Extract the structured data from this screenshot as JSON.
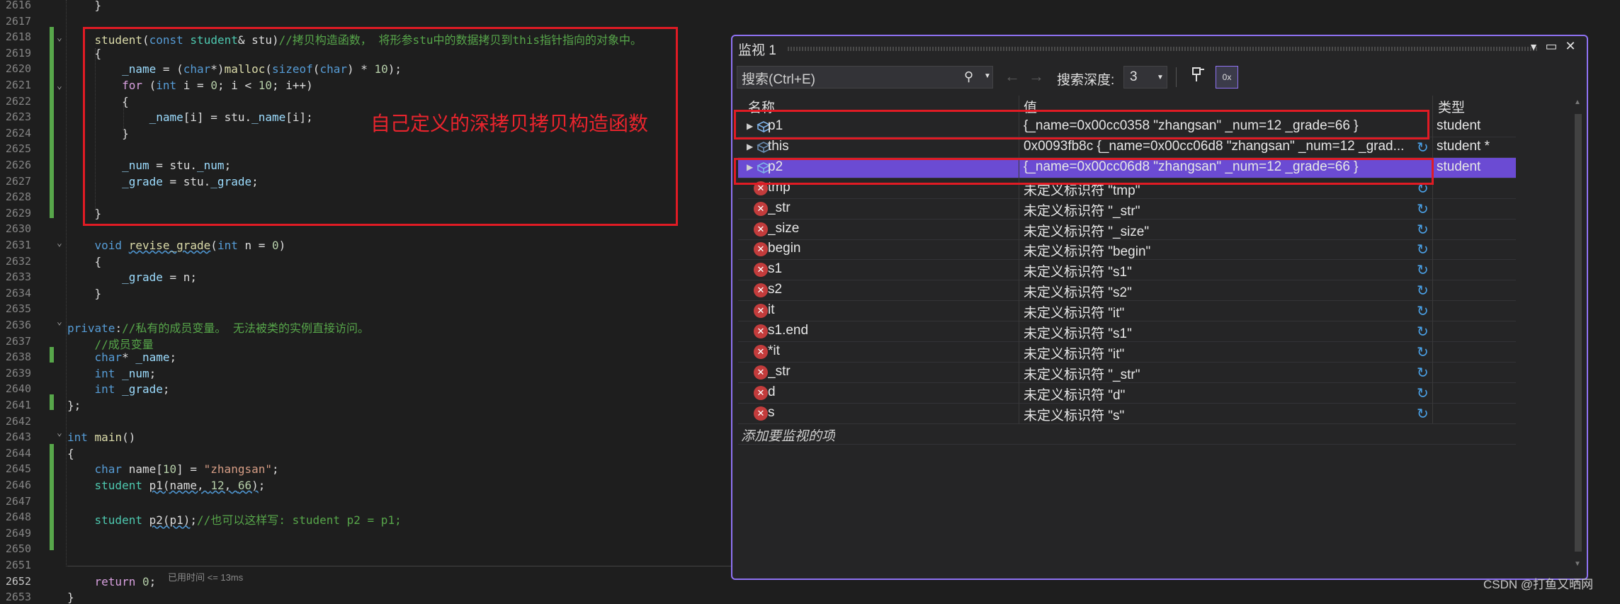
{
  "editor": {
    "lines": [
      {
        "num": "2616",
        "html": "    }"
      },
      {
        "num": "2617",
        "html": ""
      },
      {
        "num": "2618",
        "html": "    <span class='fn'>student</span>(<span class='kw'>const</span> <span class='ty'>student</span>&amp; stu)<span class='cm'>//拷贝构造函数， 将形参stu中的数据拷贝到this指针指向的对象中。</span>"
      },
      {
        "num": "2619",
        "html": "    {"
      },
      {
        "num": "2620",
        "html": "        <span class='fld'>_name</span> = (<span class='kw'>char</span>*)<span class='fn'>malloc</span>(<span class='kw'>sizeof</span>(<span class='kw'>char</span>) * <span class='num'>10</span>);"
      },
      {
        "num": "2621",
        "html": "        <span class='ctrl'>for</span> (<span class='kw'>int</span> i = <span class='num'>0</span>; i &lt; <span class='num'>10</span>; i++)"
      },
      {
        "num": "2622",
        "html": "        {"
      },
      {
        "num": "2623",
        "html": "            <span class='fld'>_name</span>[i] = stu.<span class='fld'>_name</span>[i];"
      },
      {
        "num": "2624",
        "html": "        }"
      },
      {
        "num": "2625",
        "html": ""
      },
      {
        "num": "2626",
        "html": "        <span class='fld'>_num</span> = stu.<span class='fld'>_num</span>;"
      },
      {
        "num": "2627",
        "html": "        <span class='fld'>_grade</span> = stu.<span class='fld'>_grade</span>;"
      },
      {
        "num": "2628",
        "html": ""
      },
      {
        "num": "2629",
        "html": "    }"
      },
      {
        "num": "2630",
        "html": ""
      },
      {
        "num": "2631",
        "html": "    <span class='kw'>void</span> <span class='fn sq'>revise_grade</span>(<span class='kw'>int</span> n = <span class='num'>0</span>)"
      },
      {
        "num": "2632",
        "html": "    {"
      },
      {
        "num": "2633",
        "html": "        <span class='fld'>_grade</span> = n;"
      },
      {
        "num": "2634",
        "html": "    }"
      },
      {
        "num": "2635",
        "html": ""
      },
      {
        "num": "2636",
        "html": "<span class='kw'>private</span>:<span class='cm'>//私有的成员变量。 无法被类的实例直接访问。</span>"
      },
      {
        "num": "2637",
        "html": "    <span class='cm'>//成员变量</span>"
      },
      {
        "num": "2638",
        "html": "    <span class='kw'>char</span>* <span class='fld'>_name</span>;"
      },
      {
        "num": "2639",
        "html": "    <span class='kw'>int</span> <span class='fld'>_num</span>;"
      },
      {
        "num": "2640",
        "html": "    <span class='kw'>int</span> <span class='fld'>_grade</span>;"
      },
      {
        "num": "2641",
        "html": "};"
      },
      {
        "num": "2642",
        "html": ""
      },
      {
        "num": "2643",
        "html": "<span class='kw'>int</span> <span class='fn'>main</span>()"
      },
      {
        "num": "2644",
        "html": "{"
      },
      {
        "num": "2645",
        "html": "    <span class='kw'>char</span> name[<span class='num'>10</span>] = <span class='str'>\"zhangsan\"</span>;"
      },
      {
        "num": "2646",
        "html": "    <span class='ty'>student</span> <span class='sq'>p1(name, <span class='num'>12</span>, <span class='num'>66</span>)</span>;"
      },
      {
        "num": "2647",
        "html": ""
      },
      {
        "num": "2648",
        "html": "    <span class='ty'>student</span> <span class='sq'>p2(p1)</span>;<span class='cm'>//也可以这样写: student p2 = p1;</span>"
      },
      {
        "num": "2649",
        "html": ""
      },
      {
        "num": "2650",
        "html": ""
      },
      {
        "num": "2651",
        "html": ""
      },
      {
        "num": "2652",
        "html": "    <span class='ctrl'>return</span> <span class='num'>0</span>;"
      },
      {
        "num": "2653",
        "html": "}"
      }
    ],
    "annotation": "自己定义的深拷贝拷贝构造函数",
    "elapsed": "已用时间 <= 13ms"
  },
  "watch": {
    "title": "监视 1",
    "search_placeholder": "搜索(Ctrl+E)",
    "depth_label": "搜索深度:",
    "depth_value": "3",
    "columns": {
      "name": "名称",
      "value": "值",
      "type": "类型"
    },
    "rows": [
      {
        "name": "p1",
        "value": "{_name=0x00cc0358 \"zhangsan\" _num=12 _grade=66 }",
        "type": "student",
        "kind": "object",
        "expandable": true,
        "selected": false,
        "refresh": false
      },
      {
        "name": "this",
        "value": "0x0093fb8c {_name=0x00cc06d8 \"zhangsan\" _num=12 _grad...",
        "type": "student *",
        "kind": "object-dim",
        "expandable": true,
        "selected": false,
        "refresh": true
      },
      {
        "name": "p2",
        "value": "{_name=0x00cc06d8 \"zhangsan\" _num=12 _grade=66 }",
        "type": "student",
        "kind": "object",
        "expandable": true,
        "selected": true,
        "refresh": false
      },
      {
        "name": "tmp",
        "value": "未定义标识符 \"tmp\"",
        "type": "",
        "kind": "error",
        "expandable": false,
        "selected": false,
        "refresh": true
      },
      {
        "name": "_str",
        "value": "未定义标识符 \"_str\"",
        "type": "",
        "kind": "error",
        "expandable": false,
        "selected": false,
        "refresh": true
      },
      {
        "name": "_size",
        "value": "未定义标识符 \"_size\"",
        "type": "",
        "kind": "error",
        "expandable": false,
        "selected": false,
        "refresh": true
      },
      {
        "name": "begin",
        "value": "未定义标识符 \"begin\"",
        "type": "",
        "kind": "error",
        "expandable": false,
        "selected": false,
        "refresh": true
      },
      {
        "name": "s1",
        "value": "未定义标识符 \"s1\"",
        "type": "",
        "kind": "error",
        "expandable": false,
        "selected": false,
        "refresh": true
      },
      {
        "name": "s2",
        "value": "未定义标识符 \"s2\"",
        "type": "",
        "kind": "error",
        "expandable": false,
        "selected": false,
        "refresh": true
      },
      {
        "name": "it",
        "value": "未定义标识符 \"it\"",
        "type": "",
        "kind": "error",
        "expandable": false,
        "selected": false,
        "refresh": true
      },
      {
        "name": "s1.end",
        "value": "未定义标识符 \"s1\"",
        "type": "",
        "kind": "error",
        "expandable": false,
        "selected": false,
        "refresh": true
      },
      {
        "name": "*it",
        "value": "未定义标识符 \"it\"",
        "type": "",
        "kind": "error",
        "expandable": false,
        "selected": false,
        "refresh": true
      },
      {
        "name": "_str",
        "value": "未定义标识符 \"_str\"",
        "type": "",
        "kind": "error",
        "expandable": false,
        "selected": false,
        "refresh": true
      },
      {
        "name": "d",
        "value": "未定义标识符 \"d\"",
        "type": "",
        "kind": "error",
        "expandable": false,
        "selected": false,
        "refresh": true
      },
      {
        "name": "s",
        "value": "未定义标识符 \"s\"",
        "type": "",
        "kind": "error",
        "expandable": false,
        "selected": false,
        "refresh": true
      }
    ],
    "add_item": "添加要监视的项"
  },
  "watermark": "CSDN @打鱼又晒网",
  "colors": {
    "accent": "#8f72f3",
    "selection": "#6b4bd3",
    "highlight_box": "#e01b24",
    "annotation": "#e8242d"
  },
  "icons": [
    "chevron-down-icon",
    "pin-icon",
    "maximize-icon",
    "close-icon",
    "search-icon",
    "back-arrow-icon",
    "forward-arrow-icon",
    "pin-watch-icon",
    "hex-display-icon",
    "expand-triangle-icon",
    "object-cube-icon",
    "error-icon",
    "refresh-icon"
  ]
}
